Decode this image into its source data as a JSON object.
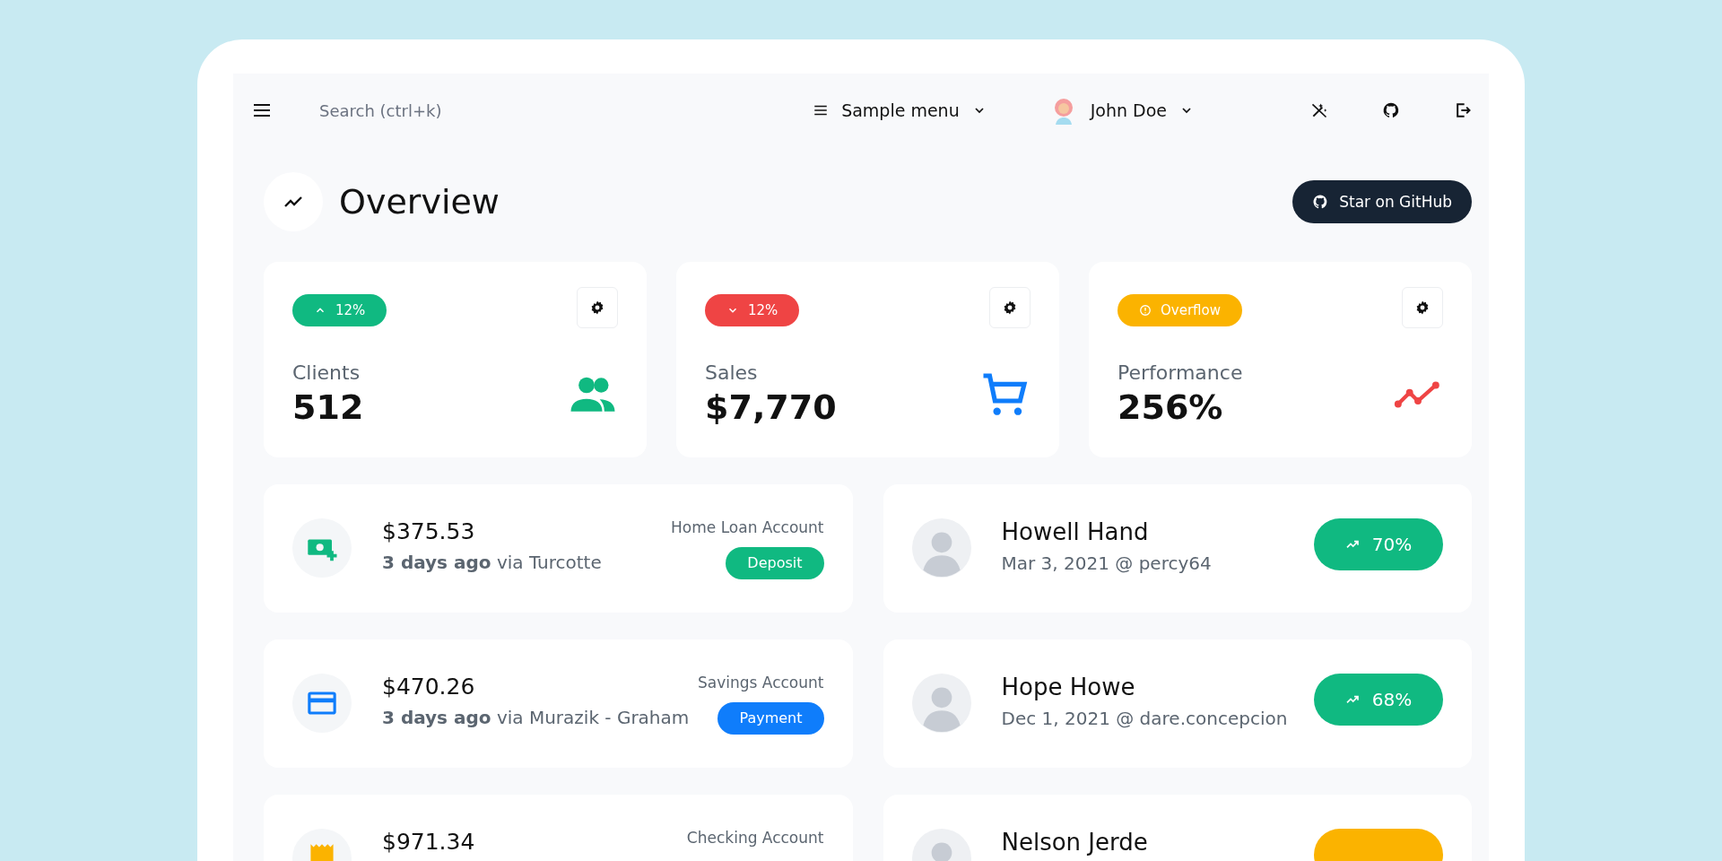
{
  "navbar": {
    "search": {
      "placeholder": "Search (ctrl+k)"
    },
    "menu": {
      "label": "Sample menu"
    },
    "user": {
      "name": "John Doe"
    }
  },
  "header": {
    "title": "Overview",
    "button": "Star on GitHub"
  },
  "stats": [
    {
      "badge": {
        "kind": "up",
        "label": "12%",
        "color": "#10b981"
      },
      "label": "Clients",
      "value": "512",
      "kind": "users",
      "color": "#10b981"
    },
    {
      "badge": {
        "kind": "down",
        "label": "12%",
        "color": "#ef4444"
      },
      "label": "Sales",
      "value": "$7,770",
      "kind": "cart",
      "color": "#0f7dfb"
    },
    {
      "badge": {
        "kind": "alert",
        "label": "Overflow",
        "color": "#fbb300"
      },
      "label": "Performance",
      "value": "256%",
      "kind": "trend",
      "color": "#ef4444"
    }
  ],
  "transactions": [
    {
      "kind": "cash",
      "color": "#10b981",
      "amount": "$375.53",
      "when": "3 days ago",
      "via": "via Turcotte",
      "account": "Home Loan Account",
      "tag": {
        "label": "Deposit",
        "color": "#10b981"
      }
    },
    {
      "kind": "card",
      "color": "#0f7dfb",
      "amount": "$470.26",
      "when": "3 days ago",
      "via": "via Murazik - Graham",
      "account": "Savings Account",
      "tag": {
        "label": "Payment",
        "color": "#0f7dfb"
      }
    },
    {
      "kind": "receipt",
      "color": "#fbb300",
      "amount": "$971.34",
      "account": "Checking Account"
    }
  ],
  "clients": [
    {
      "name": "Howell Hand",
      "meta": "Mar 3, 2021 @ percy64",
      "trend": {
        "label": "70%",
        "color": "#10b981"
      }
    },
    {
      "name": "Hope Howe",
      "meta": "Dec 1, 2021 @ dare.concepcion",
      "trend": {
        "label": "68%",
        "color": "#10b981"
      }
    },
    {
      "name": "Nelson Jerde",
      "trend": {
        "color": "#fbb300"
      }
    }
  ]
}
